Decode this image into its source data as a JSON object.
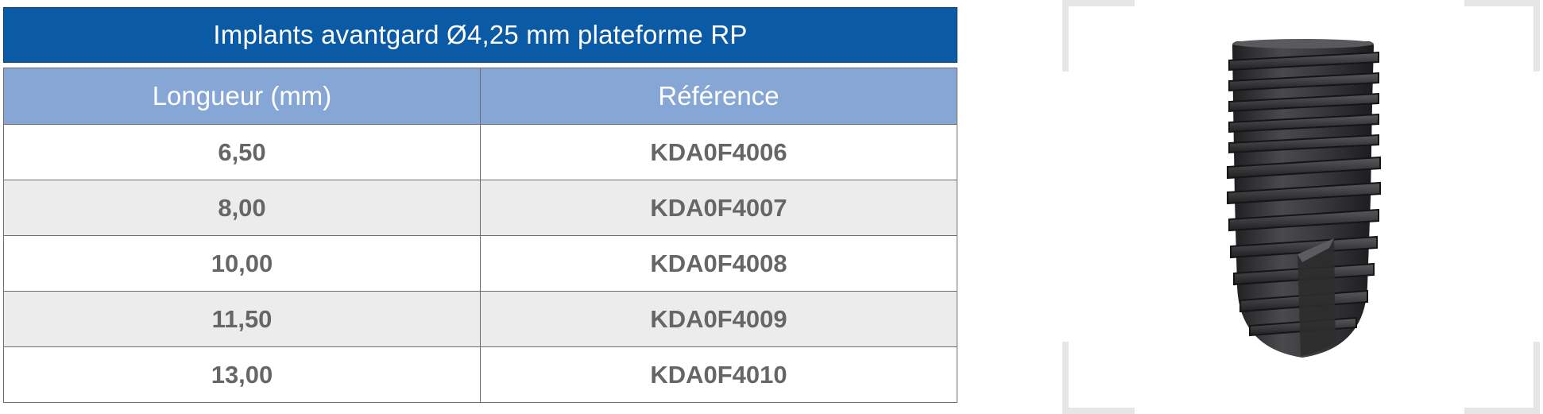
{
  "table": {
    "title": "Implants avantgard Ø4,25 mm plateforme RP",
    "headers": [
      "Longueur (mm)",
      "Référence"
    ],
    "rows": [
      [
        "6,50",
        "KDA0F4006"
      ],
      [
        "8,00",
        "KDA0F4007"
      ],
      [
        "10,00",
        "KDA0F4008"
      ],
      [
        "11,50",
        "KDA0F4009"
      ],
      [
        "13,00",
        "KDA0F4010"
      ]
    ]
  },
  "product_image": {
    "icon": "dental-implant-icon",
    "colors": {
      "implant": "#3a3a3c",
      "frame": "#e6e6e6",
      "header": "#0b5aa6",
      "subheader": "#86a6d6"
    }
  }
}
